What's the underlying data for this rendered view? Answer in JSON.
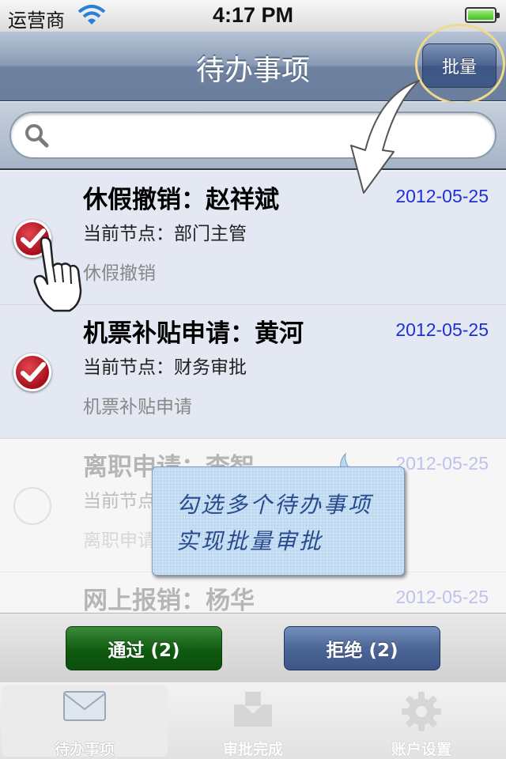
{
  "status_bar": {
    "carrier": "运营商",
    "time": "4:17 PM"
  },
  "nav": {
    "title": "待办事项",
    "batch_label": "批量"
  },
  "search": {
    "placeholder": ""
  },
  "items": [
    {
      "title": "休假撤销：赵祥斌",
      "node": "当前节点：部门主管",
      "type": "休假撤销",
      "date": "2012-05-25",
      "checked": true
    },
    {
      "title": "机票补贴申请：黄河",
      "node": "当前节点：财务审批",
      "type": "机票补贴申请",
      "date": "2012-05-25",
      "checked": true
    },
    {
      "title": "离职申请：李智",
      "node": "当前节点：部门主管",
      "type": "离职申请",
      "date": "2012-05-25",
      "checked": false
    },
    {
      "title": "网上报销：杨华",
      "node": "",
      "type": "",
      "date": "2012-05-25",
      "checked": false
    }
  ],
  "tooltip": {
    "line1": "勾选多个待办事项",
    "line2": "实现批量审批"
  },
  "actions": {
    "approve_label": "通过 (2)",
    "reject_label": "拒绝 (2)"
  },
  "tabs": [
    {
      "label": "待办事项",
      "icon": "envelope-icon"
    },
    {
      "label": "审批完成",
      "icon": "inbox-icon"
    },
    {
      "label": "账户设置",
      "icon": "gear-icon"
    }
  ],
  "colors": {
    "accent": "#6b7e9d",
    "date": "#1f2fd8",
    "approve": "#0f5a10",
    "reject": "#4b6596",
    "check": "#b0101e"
  }
}
